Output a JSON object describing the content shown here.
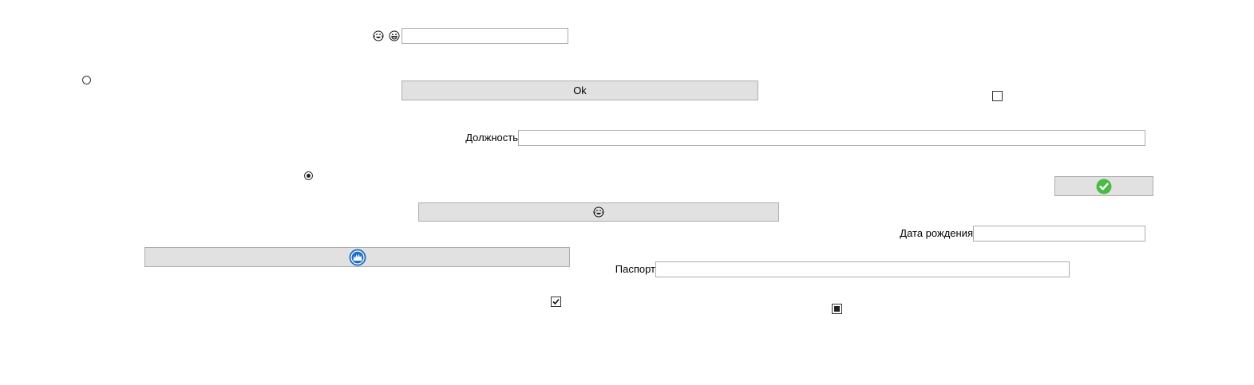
{
  "top_row": {
    "emoji_1": "face-with-tears-of-joy-icon",
    "emoji_2": "grinning-face-icon",
    "input_value": ""
  },
  "ok_button": {
    "label": "Ok"
  },
  "position_field": {
    "label": "Должность",
    "value": ""
  },
  "green_button": {
    "icon": "green-checkmark-icon"
  },
  "emoji_button": {
    "icon": "face-with-tears-of-joy-icon"
  },
  "blue_button": {
    "icon": "blue-round-logo-icon"
  },
  "birth_date_field": {
    "label": "Дата рождения",
    "value": ""
  },
  "passport_field": {
    "label": "Паспорт",
    "value": ""
  },
  "controls": {
    "radio_1_checked": false,
    "radio_2_checked": true,
    "checkbox_1": "unchecked",
    "checkbox_2": "checked",
    "checkbox_3": "indeterminate"
  },
  "colors": {
    "button_bg": "#e1e1e1",
    "button_border": "#adadad",
    "input_border": "#abadb3",
    "check_green": "#4cbb45",
    "logo_blue": "#1f6fc5"
  }
}
